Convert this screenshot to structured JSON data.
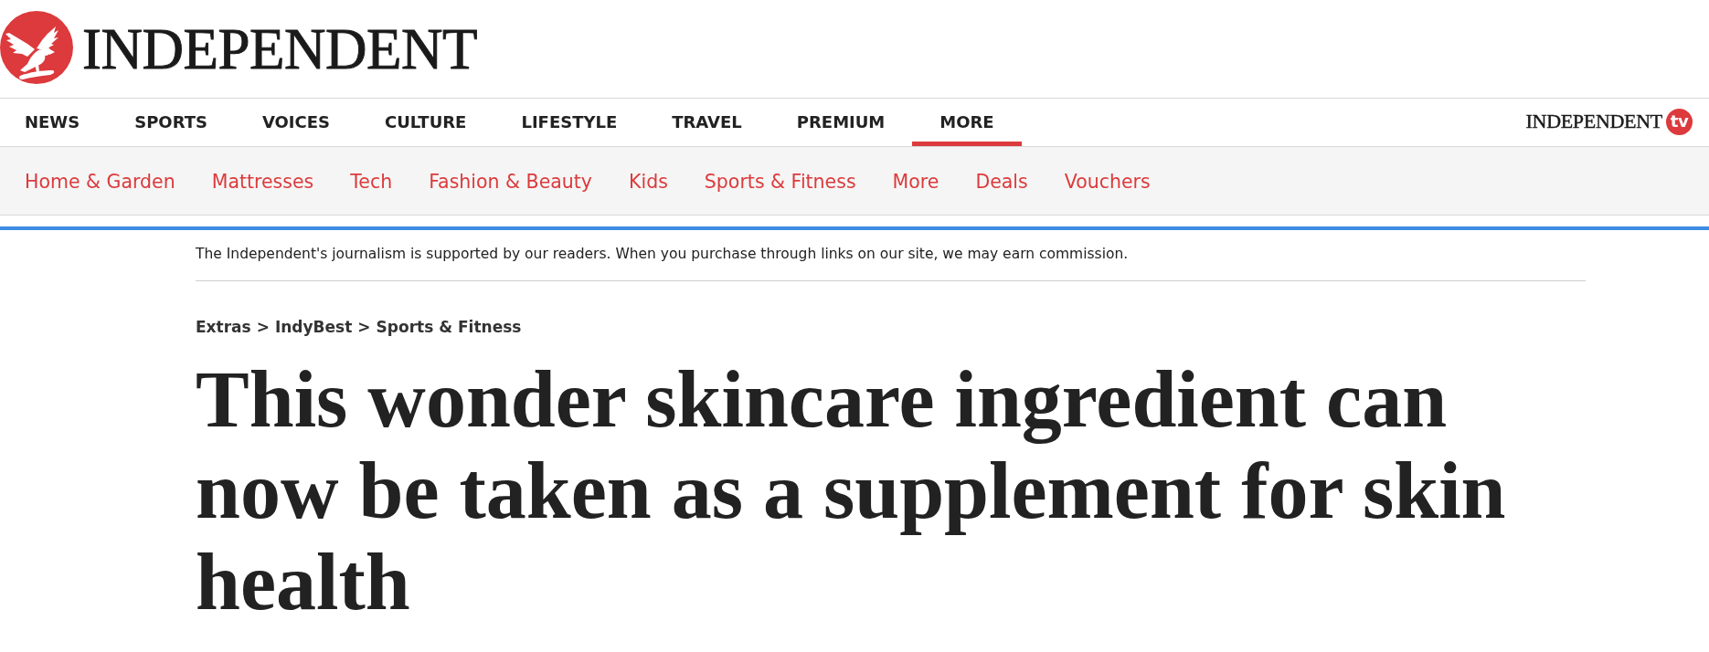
{
  "masthead": {
    "wordmark": "INDEPENDENT"
  },
  "main_nav": {
    "items": [
      {
        "label": "NEWS",
        "selected": false
      },
      {
        "label": "SPORTS",
        "selected": false
      },
      {
        "label": "VOICES",
        "selected": false
      },
      {
        "label": "CULTURE",
        "selected": false
      },
      {
        "label": "LIFESTYLE",
        "selected": false
      },
      {
        "label": "TRAVEL",
        "selected": false
      },
      {
        "label": "PREMIUM",
        "selected": false
      },
      {
        "label": "MORE",
        "selected": true
      }
    ],
    "tv_logo": {
      "wordmark": "INDEPENDENT",
      "badge": "tv"
    }
  },
  "sub_nav": {
    "items": [
      "Home & Garden",
      "Mattresses",
      "Tech",
      "Fashion & Beauty",
      "Kids",
      "Sports & Fitness",
      "More",
      "Deals",
      "Vouchers"
    ]
  },
  "disclaimer": "The Independent's journalism is supported by our readers. When you purchase through links on our site, we may earn commission.",
  "breadcrumb": {
    "items": [
      "Extras",
      "IndyBest",
      "Sports & Fitness"
    ],
    "separator": ">"
  },
  "headline": "This wonder skincare ingredient can now be taken as a supplement for skin health"
}
